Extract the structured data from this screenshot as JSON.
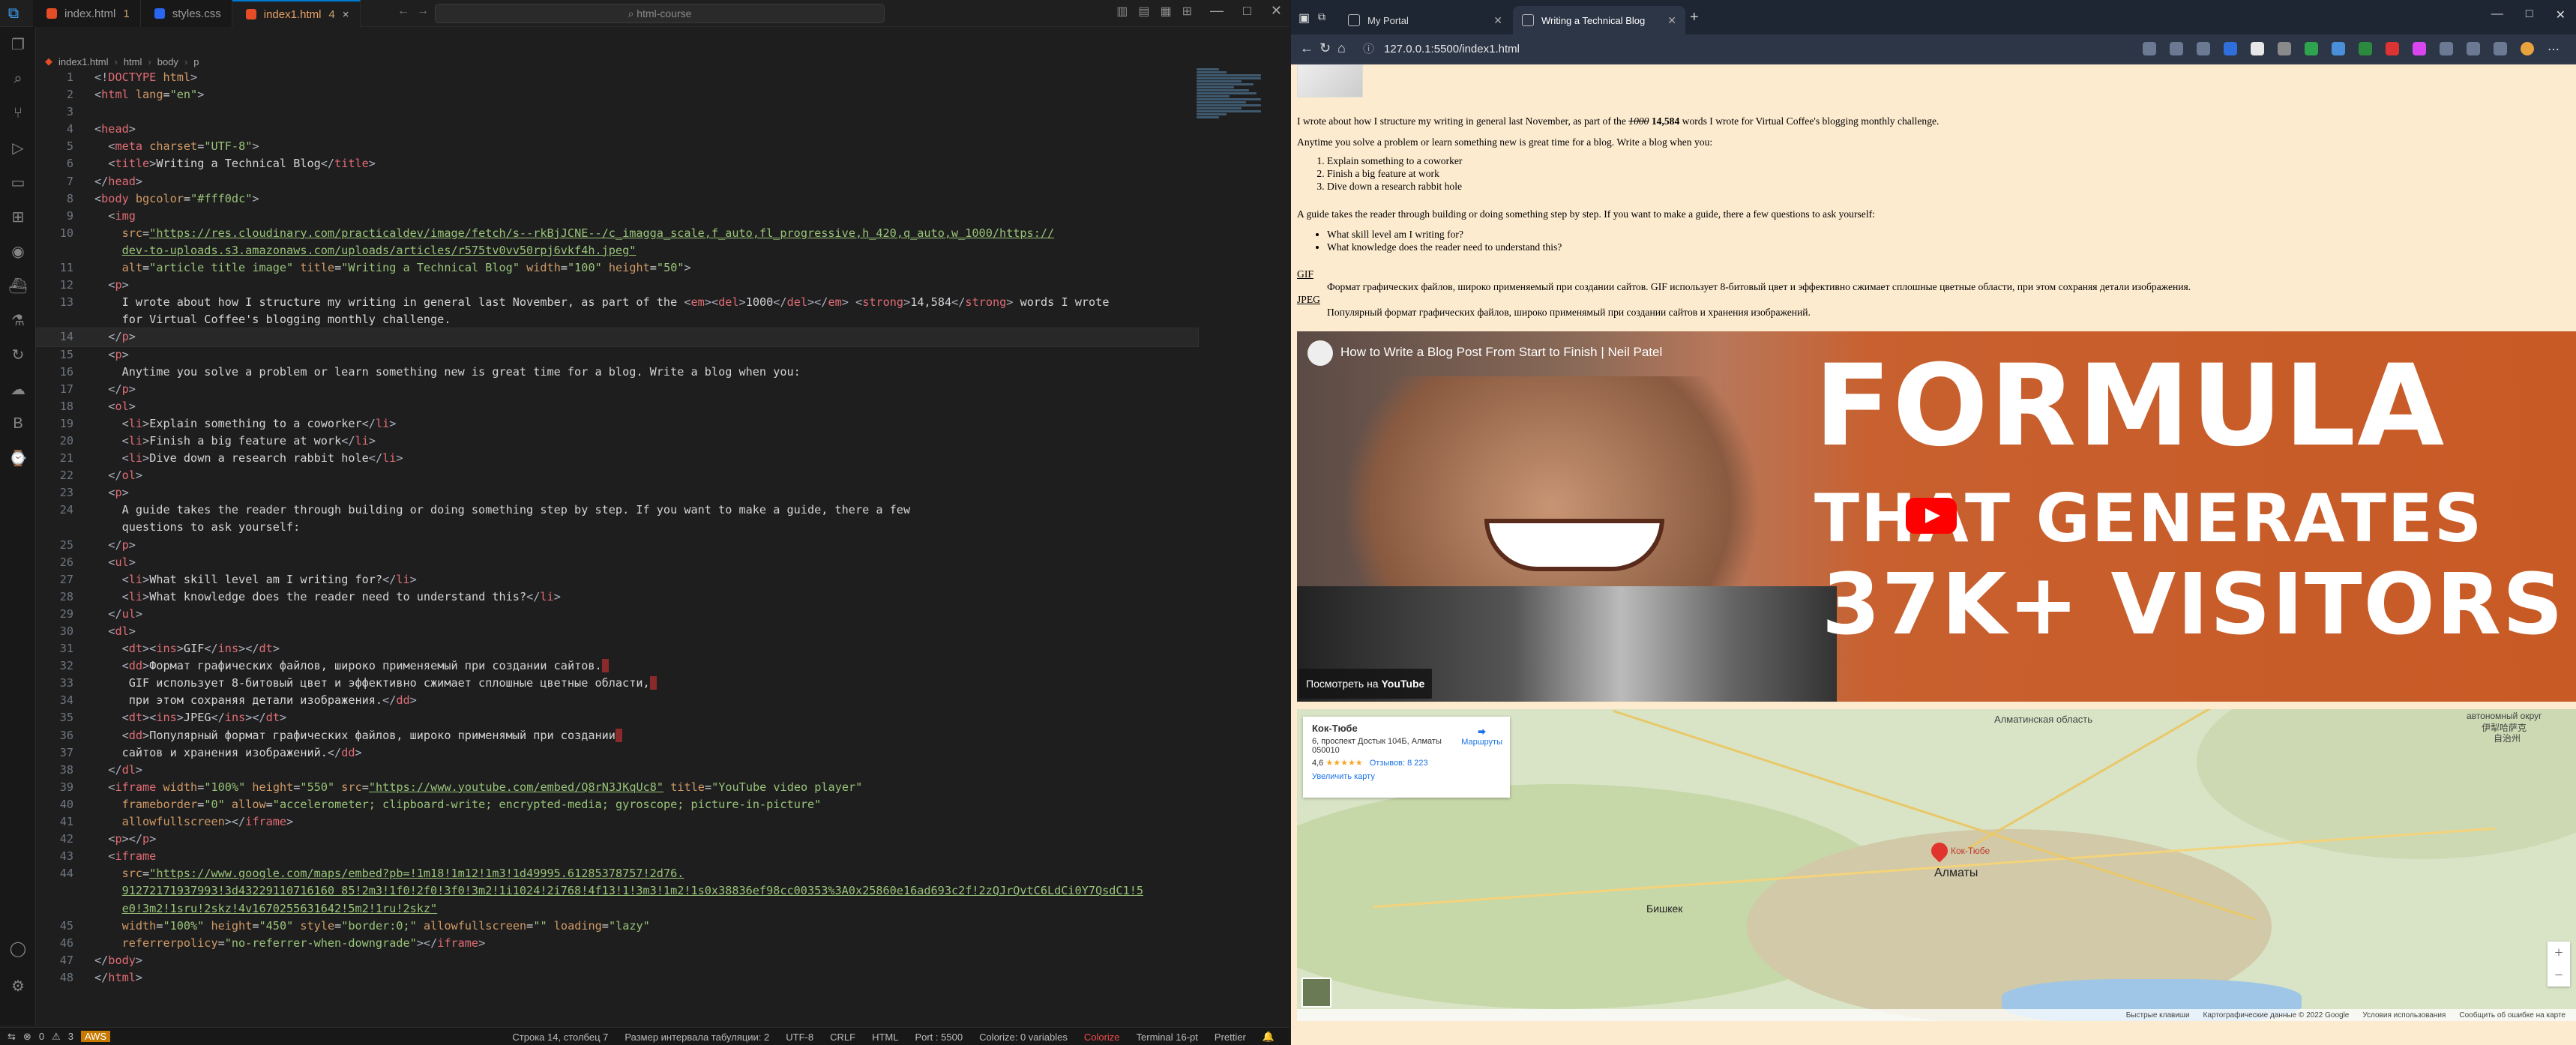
{
  "vscode": {
    "tabs": [
      {
        "label": "index.html",
        "icon": "html",
        "count": "1"
      },
      {
        "label": "styles.css",
        "icon": "css",
        "count": ""
      },
      {
        "label": "index1.html",
        "icon": "html",
        "count": "4"
      }
    ],
    "search_placeholder": "html-course",
    "breadcrumb": [
      "index1.html",
      "html",
      "body",
      "p"
    ],
    "lines": [
      {
        "n": "1",
        "html": "<span class='b'>&lt;!</span><span class='t'>DOCTYPE</span> <span class='a'>html</span><span class='b'>&gt;</span>"
      },
      {
        "n": "2",
        "html": "<span class='b'>&lt;</span><span class='t'>html</span> <span class='a'>lang</span>=<span class='s'>\"en\"</span><span class='b'>&gt;</span>"
      },
      {
        "n": "3",
        "html": ""
      },
      {
        "n": "4",
        "html": "<span class='b'>&lt;</span><span class='t'>head</span><span class='b'>&gt;</span>"
      },
      {
        "n": "5",
        "html": "  <span class='b'>&lt;</span><span class='t'>meta</span> <span class='a'>charset</span>=<span class='s'>\"UTF-8\"</span><span class='b'>&gt;</span>"
      },
      {
        "n": "6",
        "html": "  <span class='b'>&lt;</span><span class='t'>title</span><span class='b'>&gt;</span><span class='tx'>Writing a Technical Blog</span><span class='b'>&lt;/</span><span class='t'>title</span><span class='b'>&gt;</span>"
      },
      {
        "n": "7",
        "html": "<span class='b'>&lt;/</span><span class='t'>head</span><span class='b'>&gt;</span>"
      },
      {
        "n": "8",
        "html": "<span class='b'>&lt;</span><span class='t'>body</span> <span class='a'>bgcolor</span>=<span class='s'>\"#fff0dc\"</span><span class='b'>&gt;</span>"
      },
      {
        "n": "9",
        "html": "  <span class='b'>&lt;</span><span class='t'>img</span>"
      },
      {
        "n": "10",
        "html": "    <span class='a'>src</span>=<span class='u'>\"https://res.cloudinary.com/practicaldev/image/fetch/s--rkBjJCNE--/c_imagga_scale,f_auto,fl_progressive,h_420,q_auto,w_1000/https://</span>"
      },
      {
        "n": "",
        "html": "    <span class='u'>dev-to-uploads.s3.amazonaws.com/uploads/articles/r575tv0vv50rpj6vkf4h.jpeg\"</span>"
      },
      {
        "n": "11",
        "html": "    <span class='a'>alt</span>=<span class='s'>\"article title image\"</span> <span class='a'>title</span>=<span class='s'>\"Writing a Technical Blog\"</span> <span class='a'>width</span>=<span class='s'>\"100\"</span> <span class='a'>height</span>=<span class='s'>\"50\"</span><span class='b'>&gt;</span>"
      },
      {
        "n": "12",
        "html": "  <span class='b'>&lt;</span><span class='t'>p</span><span class='b'>&gt;</span>"
      },
      {
        "n": "13",
        "html": "    <span class='tx'>I wrote about how I structure my writing in general last November, as part of the </span><span class='b'>&lt;</span><span class='t'>em</span><span class='b'>&gt;&lt;</span><span class='t'>del</span><span class='b'>&gt;</span><span class='tx'>1000</span><span class='b'>&lt;/</span><span class='t'>del</span><span class='b'>&gt;&lt;/</span><span class='t'>em</span><span class='b'>&gt;</span> <span class='b'>&lt;</span><span class='t'>strong</span><span class='b'>&gt;</span><span class='tx'>14,584</span><span class='b'>&lt;/</span><span class='t'>strong</span><span class='b'>&gt;</span><span class='tx'> words I wrote</span>"
      },
      {
        "n": "",
        "html": "    <span class='tx'>for Virtual Coffee's blogging monthly challenge.</span>"
      },
      {
        "n": "14",
        "html": "  <span class='b'>&lt;/</span><span class='t'>p</span><span class='b'>&gt;</span>",
        "current": true
      },
      {
        "n": "15",
        "html": "  <span class='b'>&lt;</span><span class='t'>p</span><span class='b'>&gt;</span>"
      },
      {
        "n": "16",
        "html": "    <span class='tx'>Anytime you solve a problem or learn something new is great time for a blog. Write a blog when you:</span>"
      },
      {
        "n": "17",
        "html": "  <span class='b'>&lt;/</span><span class='t'>p</span><span class='b'>&gt;</span>"
      },
      {
        "n": "18",
        "html": "  <span class='b'>&lt;</span><span class='t'>ol</span><span class='b'>&gt;</span>"
      },
      {
        "n": "19",
        "html": "    <span class='b'>&lt;</span><span class='t'>li</span><span class='b'>&gt;</span><span class='tx'>Explain something to a coworker</span><span class='b'>&lt;/</span><span class='t'>li</span><span class='b'>&gt;</span>"
      },
      {
        "n": "20",
        "html": "    <span class='b'>&lt;</span><span class='t'>li</span><span class='b'>&gt;</span><span class='tx'>Finish a big feature at work</span><span class='b'>&lt;/</span><span class='t'>li</span><span class='b'>&gt;</span>"
      },
      {
        "n": "21",
        "html": "    <span class='b'>&lt;</span><span class='t'>li</span><span class='b'>&gt;</span><span class='tx'>Dive down a research rabbit hole</span><span class='b'>&lt;/</span><span class='t'>li</span><span class='b'>&gt;</span>"
      },
      {
        "n": "22",
        "html": "  <span class='b'>&lt;/</span><span class='t'>ol</span><span class='b'>&gt;</span>"
      },
      {
        "n": "23",
        "html": "  <span class='b'>&lt;</span><span class='t'>p</span><span class='b'>&gt;</span>"
      },
      {
        "n": "24",
        "html": "    <span class='tx'>A guide takes the reader through building or doing something step by step. If you want to make a guide, there a few</span>"
      },
      {
        "n": "",
        "html": "    <span class='tx'>questions to ask yourself:</span>"
      },
      {
        "n": "25",
        "html": "  <span class='b'>&lt;/</span><span class='t'>p</span><span class='b'>&gt;</span>"
      },
      {
        "n": "26",
        "html": "  <span class='b'>&lt;</span><span class='t'>ul</span><span class='b'>&gt;</span>"
      },
      {
        "n": "27",
        "html": "    <span class='b'>&lt;</span><span class='t'>li</span><span class='b'>&gt;</span><span class='tx'>What skill level am I writing for?</span><span class='b'>&lt;/</span><span class='t'>li</span><span class='b'>&gt;</span>"
      },
      {
        "n": "28",
        "html": "    <span class='b'>&lt;</span><span class='t'>li</span><span class='b'>&gt;</span><span class='tx'>What knowledge does the reader need to understand this?</span><span class='b'>&lt;/</span><span class='t'>li</span><span class='b'>&gt;</span>"
      },
      {
        "n": "29",
        "html": "  <span class='b'>&lt;/</span><span class='t'>ul</span><span class='b'>&gt;</span>"
      },
      {
        "n": "30",
        "html": "  <span class='b'>&lt;</span><span class='t'>dl</span><span class='b'>&gt;</span>"
      },
      {
        "n": "31",
        "html": "    <span class='b'>&lt;</span><span class='t'>dt</span><span class='b'>&gt;&lt;</span><span class='t'>ins</span><span class='b'>&gt;</span><span class='tx'>GIF</span><span class='b'>&lt;/</span><span class='t'>ins</span><span class='b'>&gt;&lt;/</span><span class='t'>dt</span><span class='b'>&gt;</span>"
      },
      {
        "n": "32",
        "html": "    <span class='b'>&lt;</span><span class='t'>dd</span><span class='b'>&gt;</span><span class='tx'>Формат графических файлов, широко применяемый при создании сайтов.</span><span class='er'> </span>"
      },
      {
        "n": "33",
        "html": "     <span class='tx'>GIF использует 8-битовый цвет и эффективно сжимает сплошные цветные области,</span><span class='er'> </span>"
      },
      {
        "n": "34",
        "html": "     <span class='tx'>при этом сохраняя детали изображения.</span><span class='b'>&lt;/</span><span class='t'>dd</span><span class='b'>&gt;</span>"
      },
      {
        "n": "35",
        "html": "    <span class='b'>&lt;</span><span class='t'>dt</span><span class='b'>&gt;&lt;</span><span class='t'>ins</span><span class='b'>&gt;</span><span class='tx'>JPEG</span><span class='b'>&lt;/</span><span class='t'>ins</span><span class='b'>&gt;&lt;/</span><span class='t'>dt</span><span class='b'>&gt;</span>"
      },
      {
        "n": "36",
        "html": "    <span class='b'>&lt;</span><span class='t'>dd</span><span class='b'>&gt;</span><span class='tx'>Популярный формат графических файлов, широко применямый при создании</span><span class='er'> </span>"
      },
      {
        "n": "37",
        "html": "    <span class='tx'>сайтов и хранения изображений.</span><span class='b'>&lt;/</span><span class='t'>dd</span><span class='b'>&gt;</span>"
      },
      {
        "n": "38",
        "html": "  <span class='b'>&lt;/</span><span class='t'>dl</span><span class='b'>&gt;</span>"
      },
      {
        "n": "39",
        "html": "  <span class='b'>&lt;</span><span class='t'>iframe</span> <span class='a'>width</span>=<span class='s'>\"100%\"</span> <span class='a'>height</span>=<span class='s'>\"550\"</span> <span class='a'>src</span>=<span class='u'>\"https://www.youtube.com/embed/Q8rN3JKqUc8\"</span> <span class='a'>title</span>=<span class='s'>\"YouTube video player\"</span>"
      },
      {
        "n": "40",
        "html": "    <span class='a'>frameborder</span>=<span class='s'>\"0\"</span> <span class='a'>allow</span>=<span class='s'>\"accelerometer; clipboard-write; encrypted-media; gyroscope; picture-in-picture\"</span>"
      },
      {
        "n": "41",
        "html": "    <span class='a'>allowfullscreen</span><span class='b'>&gt;&lt;/</span><span class='t'>iframe</span><span class='b'>&gt;</span>"
      },
      {
        "n": "42",
        "html": "  <span class='b'>&lt;</span><span class='t'>p</span><span class='b'>&gt;&lt;/</span><span class='t'>p</span><span class='b'>&gt;</span>"
      },
      {
        "n": "43",
        "html": "  <span class='b'>&lt;</span><span class='t'>iframe</span>"
      },
      {
        "n": "44",
        "html": "    <span class='a'>src</span>=<span class='u'>\"https://www.google.com/maps/embed?pb=!1m18!1m12!1m3!1d49995.61285378757!2d76.</span>"
      },
      {
        "n": "",
        "html": "    <span class='u'>91272171937993!3d43229110716160 85!2m3!1f0!2f0!3f0!3m2!1i1024!2i768!4f13!1!3m3!1m2!1s0x38836ef98cc00353%3A0x25860e16ad693c2f!2zQJrQvtC6LdCi0Y7QsdC1!5</span>"
      },
      {
        "n": "",
        "html": "    <span class='u'>e0!3m2!1sru!2skz!4v1670255631642!5m2!1ru!2skz\"</span>"
      },
      {
        "n": "45",
        "html": "    <span class='a'>width</span>=<span class='s'>\"100%\"</span> <span class='a'>height</span>=<span class='s'>\"450\"</span> <span class='a'>style</span>=<span class='s'>\"border:0;\"</span> <span class='a'>allowfullscreen</span>=<span class='s'>\"\"</span> <span class='a'>loading</span>=<span class='s'>\"lazy\"</span>"
      },
      {
        "n": "46",
        "html": "    <span class='a'>referrerpolicy</span>=<span class='s'>\"no-referrer-when-downgrade\"</span><span class='b'>&gt;&lt;/</span><span class='t'>iframe</span><span class='b'>&gt;</span>"
      },
      {
        "n": "47",
        "html": "<span class='b'>&lt;/</span><span class='t'>body</span><span class='b'>&gt;</span>"
      },
      {
        "n": "48",
        "html": "<span class='b'>&lt;/</span><span class='t'>html</span><span class='b'>&gt;</span>"
      }
    ],
    "status": {
      "errors": "0",
      "warnings": "3",
      "aws": "AWS",
      "position": "Строка 14, столбец 7",
      "indent": "Размер интервала табуляции: 2",
      "encoding": "UTF-8",
      "eol": "CRLF",
      "lang": "HTML",
      "port": "Port : 5500",
      "colorize": "Colorize: 0 variables",
      "colorize2": "Colorize",
      "terminal": "Terminal 16-pt",
      "prettier": "Prettier"
    }
  },
  "browser": {
    "tabs": [
      {
        "label": "My Portal"
      },
      {
        "label": "Writing a Technical Blog"
      }
    ],
    "url": "127.0.0.1:5500/index1.html",
    "page": {
      "p1_pre": "I wrote about how I structure my writing in general last November, as part of the ",
      "p1_del": "1000",
      "p1_strong": "14,584",
      "p1_post": " words I wrote for Virtual Coffee's blogging monthly challenge.",
      "p2": "Anytime you solve a problem or learn something new is great time for a blog. Write a blog when you:",
      "ol": [
        "Explain something to a coworker",
        "Finish a big feature at work",
        "Dive down a research rabbit hole"
      ],
      "p3": "A guide takes the reader through building or doing something step by step. If you want to make a guide, there a few questions to ask yourself:",
      "ul": [
        "What skill level am I writing for?",
        "What knowledge does the reader need to understand this?"
      ],
      "dt1": "GIF",
      "dd1": "Формат графических файлов, широко применяемый при создании сайтов. GIF использует 8-битовый цвет и эффективно сжимает сплошные цветные области, при этом сохраняя детали изображения.",
      "dt2": "JPEG",
      "dd2": "Популярный формат графических файлов, широко применямый при создании сайтов и хранения изображений."
    },
    "video": {
      "title": "How to Write a Blog Post From Start to Finish | Neil Patel",
      "line1": "FORMULA",
      "line2": "THAT GENERATES",
      "line3": "37K+ VISITORS",
      "watch": "Посмотреть на",
      "yt": "YouTube"
    },
    "map": {
      "card_title": "Кок-Тюбе",
      "card_addr": "6, проспект Достык 104Б, Алматы 050010",
      "rating": "4,6",
      "stars": "★★★★★",
      "reviews": "Отзывов: 8 223",
      "routes": "Маршруты",
      "enlarge": "Увеличить карту",
      "labels": [
        "Алматинская область",
        "Алматы",
        "Бишкек",
        "Кок-Тюбе",
        "автономный округ",
        "伊犁哈萨克",
        "自治州"
      ],
      "footer": [
        "Быстрые клавиши",
        "Картографические данные © 2022 Google",
        "Условия использования",
        "Сообщить об ошибке на карте"
      ]
    }
  }
}
